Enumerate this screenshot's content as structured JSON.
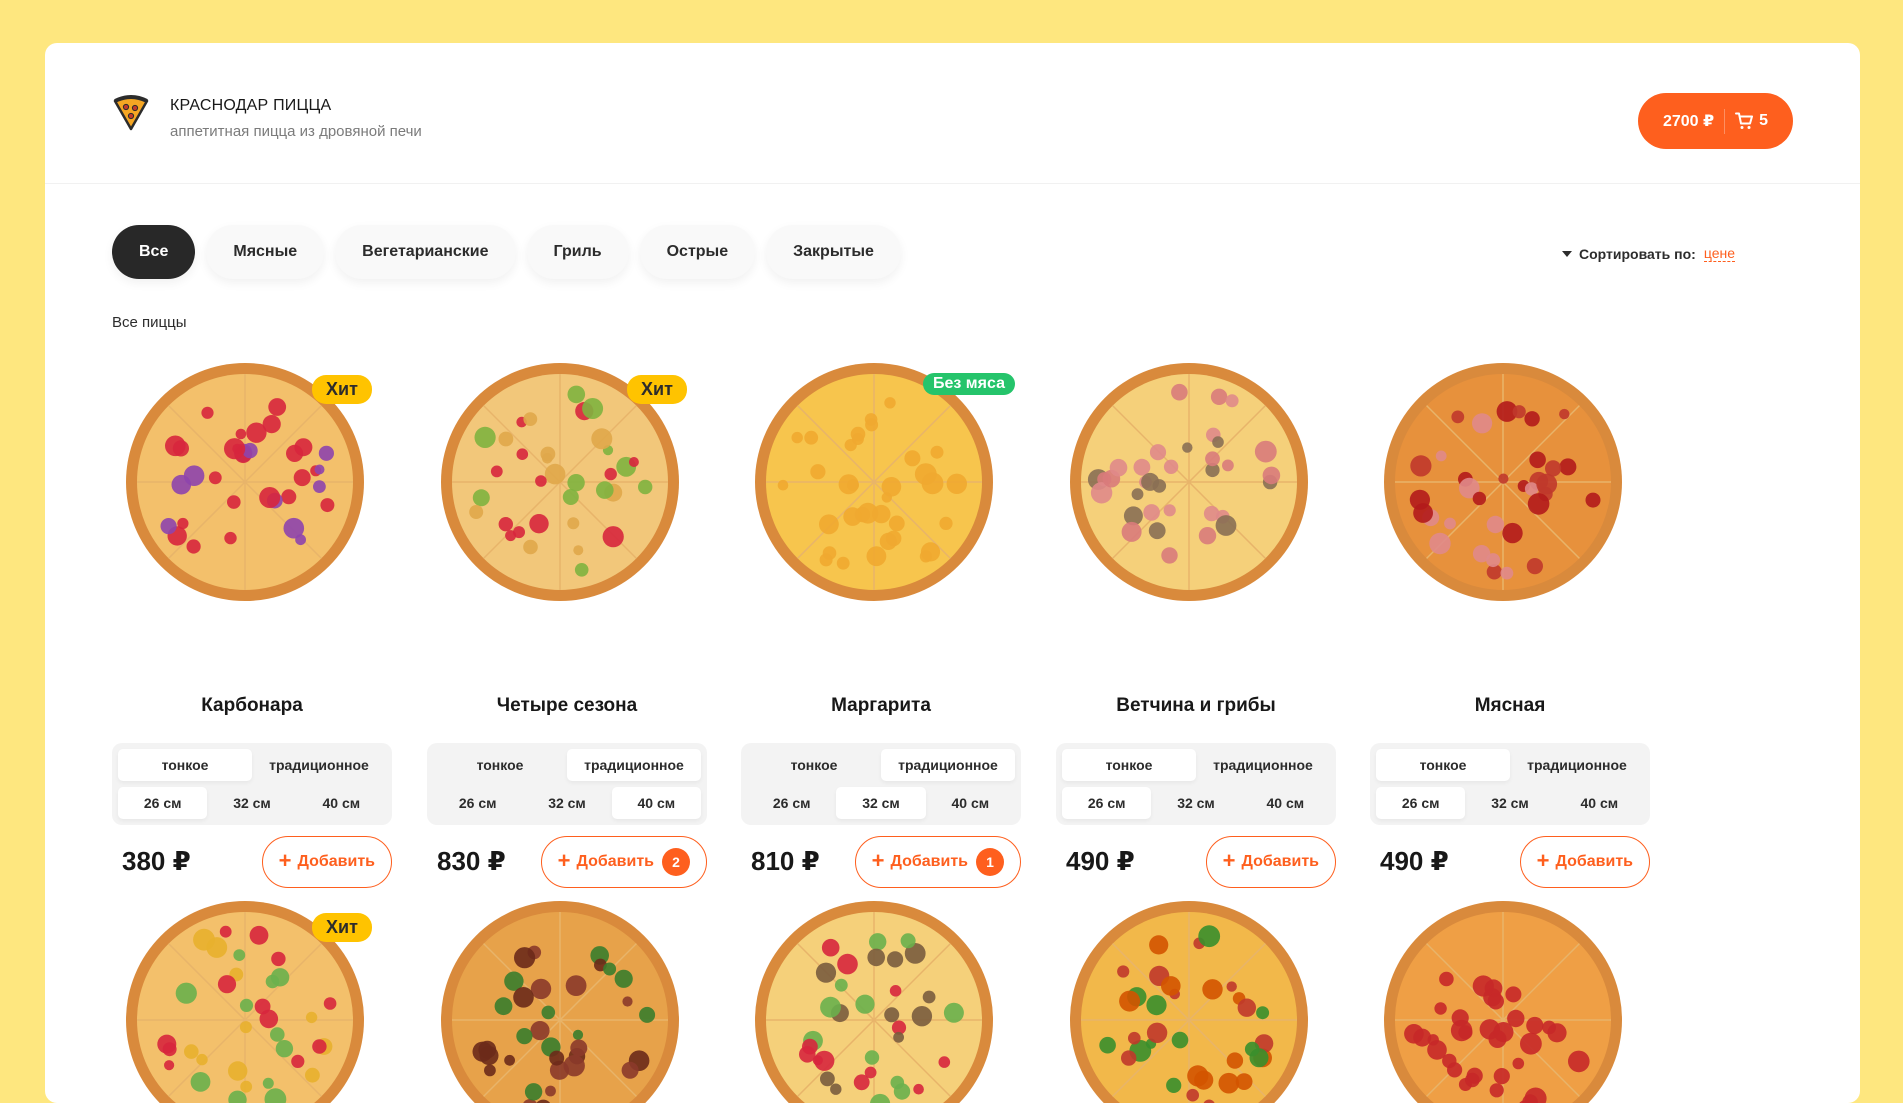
{
  "header": {
    "title": "КРАСНОДАР ПИЦЦА",
    "subtitle": "аппетитная пицца из дровяной печи",
    "cart_total": "2700 ₽",
    "cart_count": "5"
  },
  "categories": [
    "Все",
    "Мясные",
    "Вегетарианские",
    "Гриль",
    "Острые",
    "Закрытые"
  ],
  "active_category": "Все",
  "sort": {
    "label": "Сортировать по:",
    "value": "цене"
  },
  "section_title": "Все пиццы",
  "colors": {
    "accent": "#fe5f1e",
    "hit_badge": "#ffc300",
    "veg_badge": "#25c46b",
    "background": "#fee77f"
  },
  "options": {
    "dough": [
      "тонкое",
      "традиционное"
    ],
    "sizes": [
      "26 см",
      "32 см",
      "40 см"
    ],
    "add_label": "Добавить"
  },
  "pizzas": [
    {
      "name": "Карбонара",
      "price": "380 ₽",
      "badge": "Хит",
      "dough": "тонкое",
      "size": "26 см",
      "count": ""
    },
    {
      "name": "Четыре сезона",
      "price": "830 ₽",
      "badge": "Хит",
      "dough": "традиционное",
      "size": "40 см",
      "count": "2"
    },
    {
      "name": "Маргарита",
      "price": "810 ₽",
      "badge": "Без мяса",
      "dough": "традиционное",
      "size": "32 см",
      "count": "1"
    },
    {
      "name": "Ветчина и грибы",
      "price": "490 ₽",
      "badge": "",
      "dough": "тонкое",
      "size": "26 см",
      "count": ""
    },
    {
      "name": "Мясная",
      "price": "490 ₽",
      "badge": "",
      "dough": "тонкое",
      "size": "26 см",
      "count": ""
    },
    {
      "name": "",
      "price": "",
      "badge": "Хит",
      "dough": "",
      "size": "",
      "count": ""
    },
    {
      "name": "",
      "price": "",
      "badge": "",
      "dough": "",
      "size": "",
      "count": ""
    },
    {
      "name": "",
      "price": "",
      "badge": "",
      "dough": "",
      "size": "",
      "count": ""
    },
    {
      "name": "",
      "price": "",
      "badge": "",
      "dough": "",
      "size": "",
      "count": ""
    },
    {
      "name": "",
      "price": "",
      "badge": "",
      "dough": "",
      "size": "",
      "count": ""
    }
  ]
}
